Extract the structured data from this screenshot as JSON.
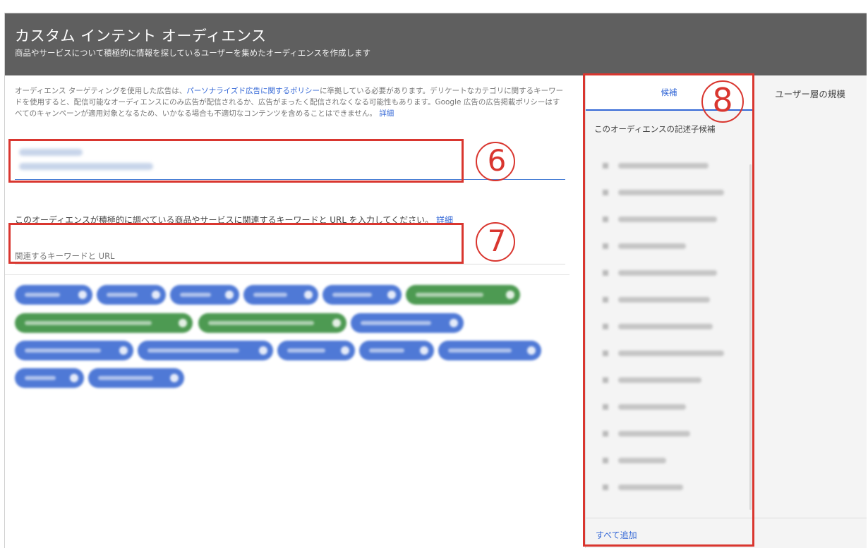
{
  "header": {
    "title": "カスタム インテント オーディエンス",
    "subtitle": "商品やサービスについて積極的に情報を探しているユーザーを集めたオーディエンスを作成します"
  },
  "policy": {
    "text_before": "オーディエンス ターゲティングを使用した広告は、",
    "link_policy": "パーソナライズド広告に関するポリシー",
    "text_after": "に準拠している必要があります。デリケートなカテゴリに関するキーワードを使用すると、配信可能なオーディエンスにのみ広告が配信されるか、広告がまったく配信されなくなる可能性もあります。Google 広告の広告掲載ポリシーはすべてのキャンペーンが適用対象となるため、いかなる場合も不適切なコンテンツを含めることはできません。",
    "link_details": "詳細"
  },
  "prompt": {
    "text": "このオーディエンスが積極的に調べている商品やサービスに関連するキーワードと URL を入力してください。",
    "link_details": "詳細"
  },
  "keyword_field": {
    "placeholder": "関連するキーワードと URL"
  },
  "right_panel": {
    "tabs": [
      "候補",
      "ユーザー層の規模"
    ],
    "subtitle": "このオーディエンスの記述子候補",
    "add_all": "すべて追加"
  },
  "annotations": {
    "six": "6",
    "seven": "7",
    "eight": "8"
  },
  "colors": {
    "accent": "#3367d6",
    "header_bg": "#5f5f5f",
    "chip_blue": "#4f79d6",
    "chip_green": "#4d9a52",
    "annotation_red": "#d9362f"
  }
}
